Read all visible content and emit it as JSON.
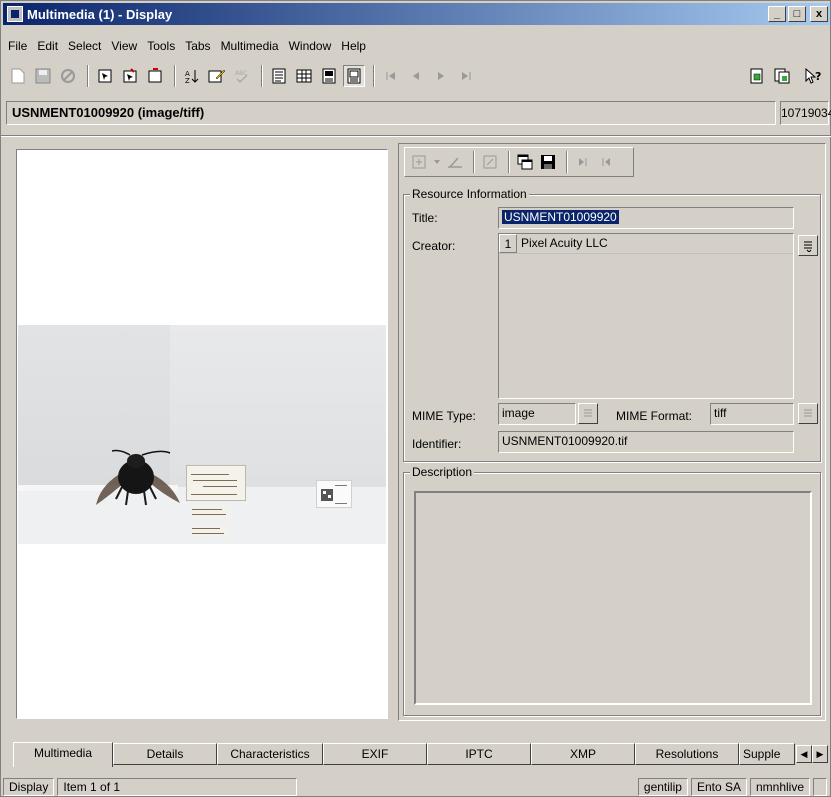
{
  "window": {
    "title": "Multimedia (1) - Display",
    "min_glyph": "_",
    "max_glyph": "□",
    "close_glyph": "x"
  },
  "menu": [
    "File",
    "Edit",
    "Select",
    "View",
    "Tools",
    "Tabs",
    "Multimedia",
    "Window",
    "Help"
  ],
  "record": {
    "heading": "USNMENT01009920 (image/tiff)",
    "id": "10719034"
  },
  "resource": {
    "group_label": "Resource Information",
    "title_label": "Title:",
    "title_value": "USNMENT01009920",
    "creator_label": "Creator:",
    "creator_index": "1",
    "creator_value": "Pixel Acuity LLC",
    "mime_type_label": "MIME Type:",
    "mime_type_value": "image",
    "mime_format_label": "MIME Format:",
    "mime_format_value": "tiff",
    "identifier_label": "Identifier:",
    "identifier_value": "USNMENT01009920.tif"
  },
  "description": {
    "group_label": "Description"
  },
  "tabs": [
    {
      "label": "Multimedia",
      "active": true
    },
    {
      "label": "Details"
    },
    {
      "label": "Characteristics"
    },
    {
      "label": "EXIF"
    },
    {
      "label": "IPTC"
    },
    {
      "label": "XMP"
    },
    {
      "label": "Resolutions"
    },
    {
      "label": "Supple"
    }
  ],
  "status": {
    "mode": "Display",
    "item": "Item 1 of 1",
    "user": "gentilip",
    "dept": "Ento SA",
    "server": "nmnhlive"
  }
}
